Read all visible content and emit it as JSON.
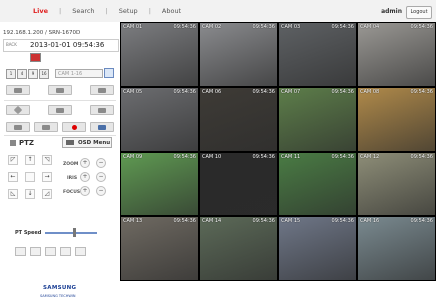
{
  "nav": {
    "live": "Live",
    "search": "Search",
    "setup": "Setup",
    "about": "About",
    "sep": "|",
    "user": "admin",
    "logout": "Logout"
  },
  "device": {
    "id": "192.168.1.200 / SRN-1670D",
    "datetime": "2013-01-01 09:54:36",
    "dt_icon": "BACK"
  },
  "split": {
    "buttons": [
      "1",
      "4",
      "9",
      "16"
    ],
    "camera_select": "CAM 1-16"
  },
  "ptz": {
    "tab_label": "PTZ",
    "osd_label": "OSD Menu",
    "zoom_label": "ZOOM",
    "iris_label": "IRIS",
    "focus_label": "FOCUS",
    "speed_label": "PT Speed",
    "speed_level": 0.55
  },
  "brand": {
    "name": "SAMSUNG",
    "sub": "SAMSUNG TECHWIN"
  },
  "cameras": [
    {
      "label": "CAM 01",
      "time": "09:54:36",
      "bg": "#7c7d80"
    },
    {
      "label": "CAM 02",
      "time": "09:54:36",
      "bg": "#8a8b8e"
    },
    {
      "label": "CAM 03",
      "time": "09:54:36",
      "bg": "#5e6164"
    },
    {
      "label": "CAM 04",
      "time": "09:54:36",
      "bg": "#9a9894"
    },
    {
      "label": "CAM 05",
      "time": "09:54:36",
      "bg": "#6c6d70"
    },
    {
      "label": "CAM 06",
      "time": "09:54:36",
      "bg": "#3e3b36"
    },
    {
      "label": "CAM 07",
      "time": "09:54:36",
      "bg": "#5d7e4a"
    },
    {
      "label": "CAM 08",
      "time": "09:54:36",
      "bg": "#b08a4a"
    },
    {
      "label": "CAM 09",
      "time": "09:54:36",
      "bg": "#5f9a52"
    },
    {
      "label": "CAM 10",
      "time": "09:54:36",
      "bg": "#2a2a2a"
    },
    {
      "label": "CAM 11",
      "time": "09:54:36",
      "bg": "#4a7c44"
    },
    {
      "label": "CAM 12",
      "time": "09:54:36",
      "bg": "#8e8e78"
    },
    {
      "label": "CAM 13",
      "time": "09:54:36",
      "bg": "#6f6a62"
    },
    {
      "label": "CAM 14",
      "time": "09:54:36",
      "bg": "#5c6a58"
    },
    {
      "label": "CAM 15",
      "time": "09:54:36",
      "bg": "#6f7788"
    },
    {
      "label": "CAM 16",
      "time": "09:54:36",
      "bg": "#7a8a90"
    }
  ]
}
